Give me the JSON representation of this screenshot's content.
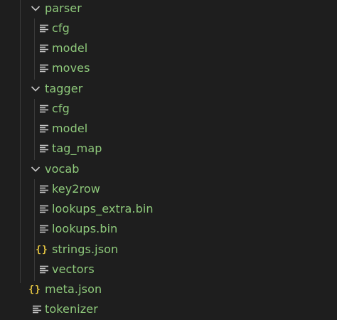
{
  "tree": {
    "folders": {
      "parser": {
        "label": "parser",
        "icon": "chevron-down-icon",
        "files": [
          {
            "label": "cfg",
            "icon": "lines-icon"
          },
          {
            "label": "model",
            "icon": "lines-icon"
          },
          {
            "label": "moves",
            "icon": "lines-icon"
          }
        ]
      },
      "tagger": {
        "label": "tagger",
        "icon": "chevron-down-icon",
        "files": [
          {
            "label": "cfg",
            "icon": "lines-icon"
          },
          {
            "label": "model",
            "icon": "lines-icon"
          },
          {
            "label": "tag_map",
            "icon": "lines-icon"
          }
        ]
      },
      "vocab": {
        "label": "vocab",
        "icon": "chevron-down-icon",
        "files": [
          {
            "label": "key2row",
            "icon": "lines-icon"
          },
          {
            "label": "lookups_extra.bin",
            "icon": "lines-icon"
          },
          {
            "label": "lookups.bin",
            "icon": "lines-icon"
          },
          {
            "label": "strings.json",
            "icon": "json-braces-icon"
          },
          {
            "label": "vectors",
            "icon": "lines-icon"
          }
        ]
      }
    },
    "root_files": [
      {
        "label": "meta.json",
        "icon": "json-braces-icon"
      },
      {
        "label": "tokenizer",
        "icon": "lines-icon"
      }
    ],
    "json_icon_glyph": "{}",
    "colors": {
      "background": "#1e1e1e",
      "label": "#8ec97b",
      "icon": "#c5c5c5",
      "json_icon": "#e2c341",
      "indent_guide": "#3a3a3a"
    }
  }
}
